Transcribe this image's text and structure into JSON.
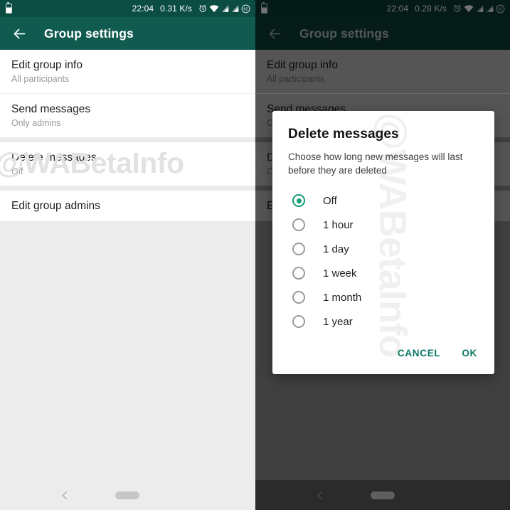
{
  "statusbar": {
    "time": "22:04",
    "speed_left": "0.31 K/s",
    "speed_right": "0.28 K/s",
    "icons": [
      "battery-icon",
      "alarm-icon",
      "wifi-icon",
      "signal-icon",
      "signal-icon",
      "battery-percent-icon"
    ],
    "battery_percent": "62"
  },
  "appbar": {
    "title": "Group settings",
    "back_icon": "back-arrow-icon"
  },
  "watermark": "@WABetaInfo",
  "settings": [
    {
      "title": "Edit group info",
      "subtitle": "All participants"
    },
    {
      "title": "Send messages",
      "subtitle": "Only admins"
    },
    {
      "title": "Delete messages",
      "subtitle": "Off"
    },
    {
      "title": "Edit group admins",
      "subtitle": ""
    }
  ],
  "dialog": {
    "title": "Delete messages",
    "description": "Choose how long new messages will last before they are deleted",
    "options": [
      {
        "label": "Off",
        "selected": true
      },
      {
        "label": "1 hour",
        "selected": false
      },
      {
        "label": "1 day",
        "selected": false
      },
      {
        "label": "1 week",
        "selected": false
      },
      {
        "label": "1 month",
        "selected": false
      },
      {
        "label": "1 year",
        "selected": false
      }
    ],
    "cancel_label": "CANCEL",
    "ok_label": "OK"
  },
  "navbar": {
    "back_icon": "nav-back-chevron-icon",
    "home_pill_icon": "home-indicator-pill"
  },
  "colors": {
    "appbar": "#105a50",
    "statusbar": "#0b4c43",
    "accent": "#0f9d76",
    "action_text": "#0b7a63",
    "background": "#ececec"
  }
}
